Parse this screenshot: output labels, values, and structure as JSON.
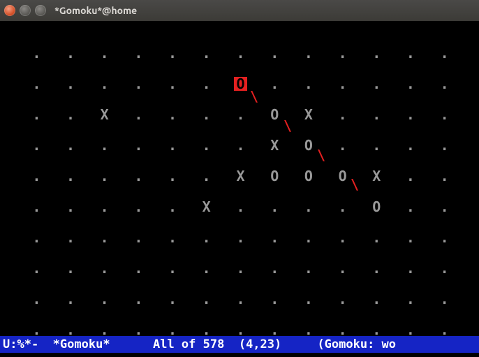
{
  "window": {
    "title": "*Gomoku*@home"
  },
  "board": {
    "cols": 13,
    "rows": 10,
    "cells": [
      {
        "r": 1,
        "c": 6,
        "v": "O",
        "cursor": true
      },
      {
        "r": 2,
        "c": 2,
        "v": "X"
      },
      {
        "r": 2,
        "c": 7,
        "v": "O"
      },
      {
        "r": 2,
        "c": 8,
        "v": "X"
      },
      {
        "r": 3,
        "c": 7,
        "v": "X"
      },
      {
        "r": 3,
        "c": 8,
        "v": "O"
      },
      {
        "r": 4,
        "c": 6,
        "v": "X"
      },
      {
        "r": 4,
        "c": 7,
        "v": "O"
      },
      {
        "r": 4,
        "c": 8,
        "v": "O"
      },
      {
        "r": 4,
        "c": 9,
        "v": "O"
      },
      {
        "r": 4,
        "c": 10,
        "v": "X"
      },
      {
        "r": 5,
        "c": 5,
        "v": "X"
      },
      {
        "r": 5,
        "c": 10,
        "v": "O"
      }
    ],
    "winline": {
      "from": {
        "r": 1,
        "c": 6
      },
      "to": {
        "r": 5,
        "c": 10
      },
      "char": "\\"
    }
  },
  "modeline": {
    "left": "U:%*-",
    "buffer": "*Gomoku*",
    "position": "All of 578",
    "coords": "(4,23)",
    "mode": "(Gomoku: wo"
  }
}
